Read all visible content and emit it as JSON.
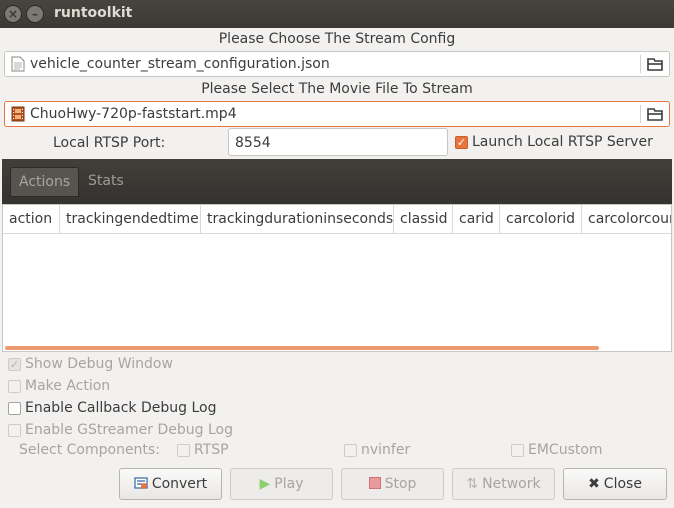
{
  "window": {
    "title": "runtoolkit"
  },
  "config": {
    "label": "Please Choose The Stream Config",
    "file": "vehicle_counter_stream_configuration.json"
  },
  "movie": {
    "label": "Please Select The Movie File To Stream",
    "file": "ChuoHwy-720p-faststart.mp4"
  },
  "rtsp": {
    "port_label": "Local RTSP Port:",
    "port_value": "8554",
    "launch_label": "Launch Local RTSP Server"
  },
  "tabs": [
    {
      "label": "Actions"
    },
    {
      "label": "Stats"
    }
  ],
  "table": {
    "columns": [
      "action",
      "trackingendedtime",
      "trackingdurationinseconds",
      "classid",
      "carid",
      "carcolorid",
      "carcolorcour"
    ]
  },
  "options": {
    "show_debug": "Show Debug Window",
    "make_action": "Make Action",
    "callback_debug": "Enable Callback Debug Log",
    "gstreamer_debug": "Enable GStreamer Debug Log",
    "select_components": "Select Components:",
    "components": [
      "RTSP",
      "nvinfer",
      "EMCustom"
    ]
  },
  "buttons": {
    "convert": "Convert",
    "play": "Play",
    "stop": "Stop",
    "network": "Network",
    "close": "Close"
  },
  "colors": {
    "accent": "#e8753d",
    "titlebar": "#3c3b37"
  }
}
